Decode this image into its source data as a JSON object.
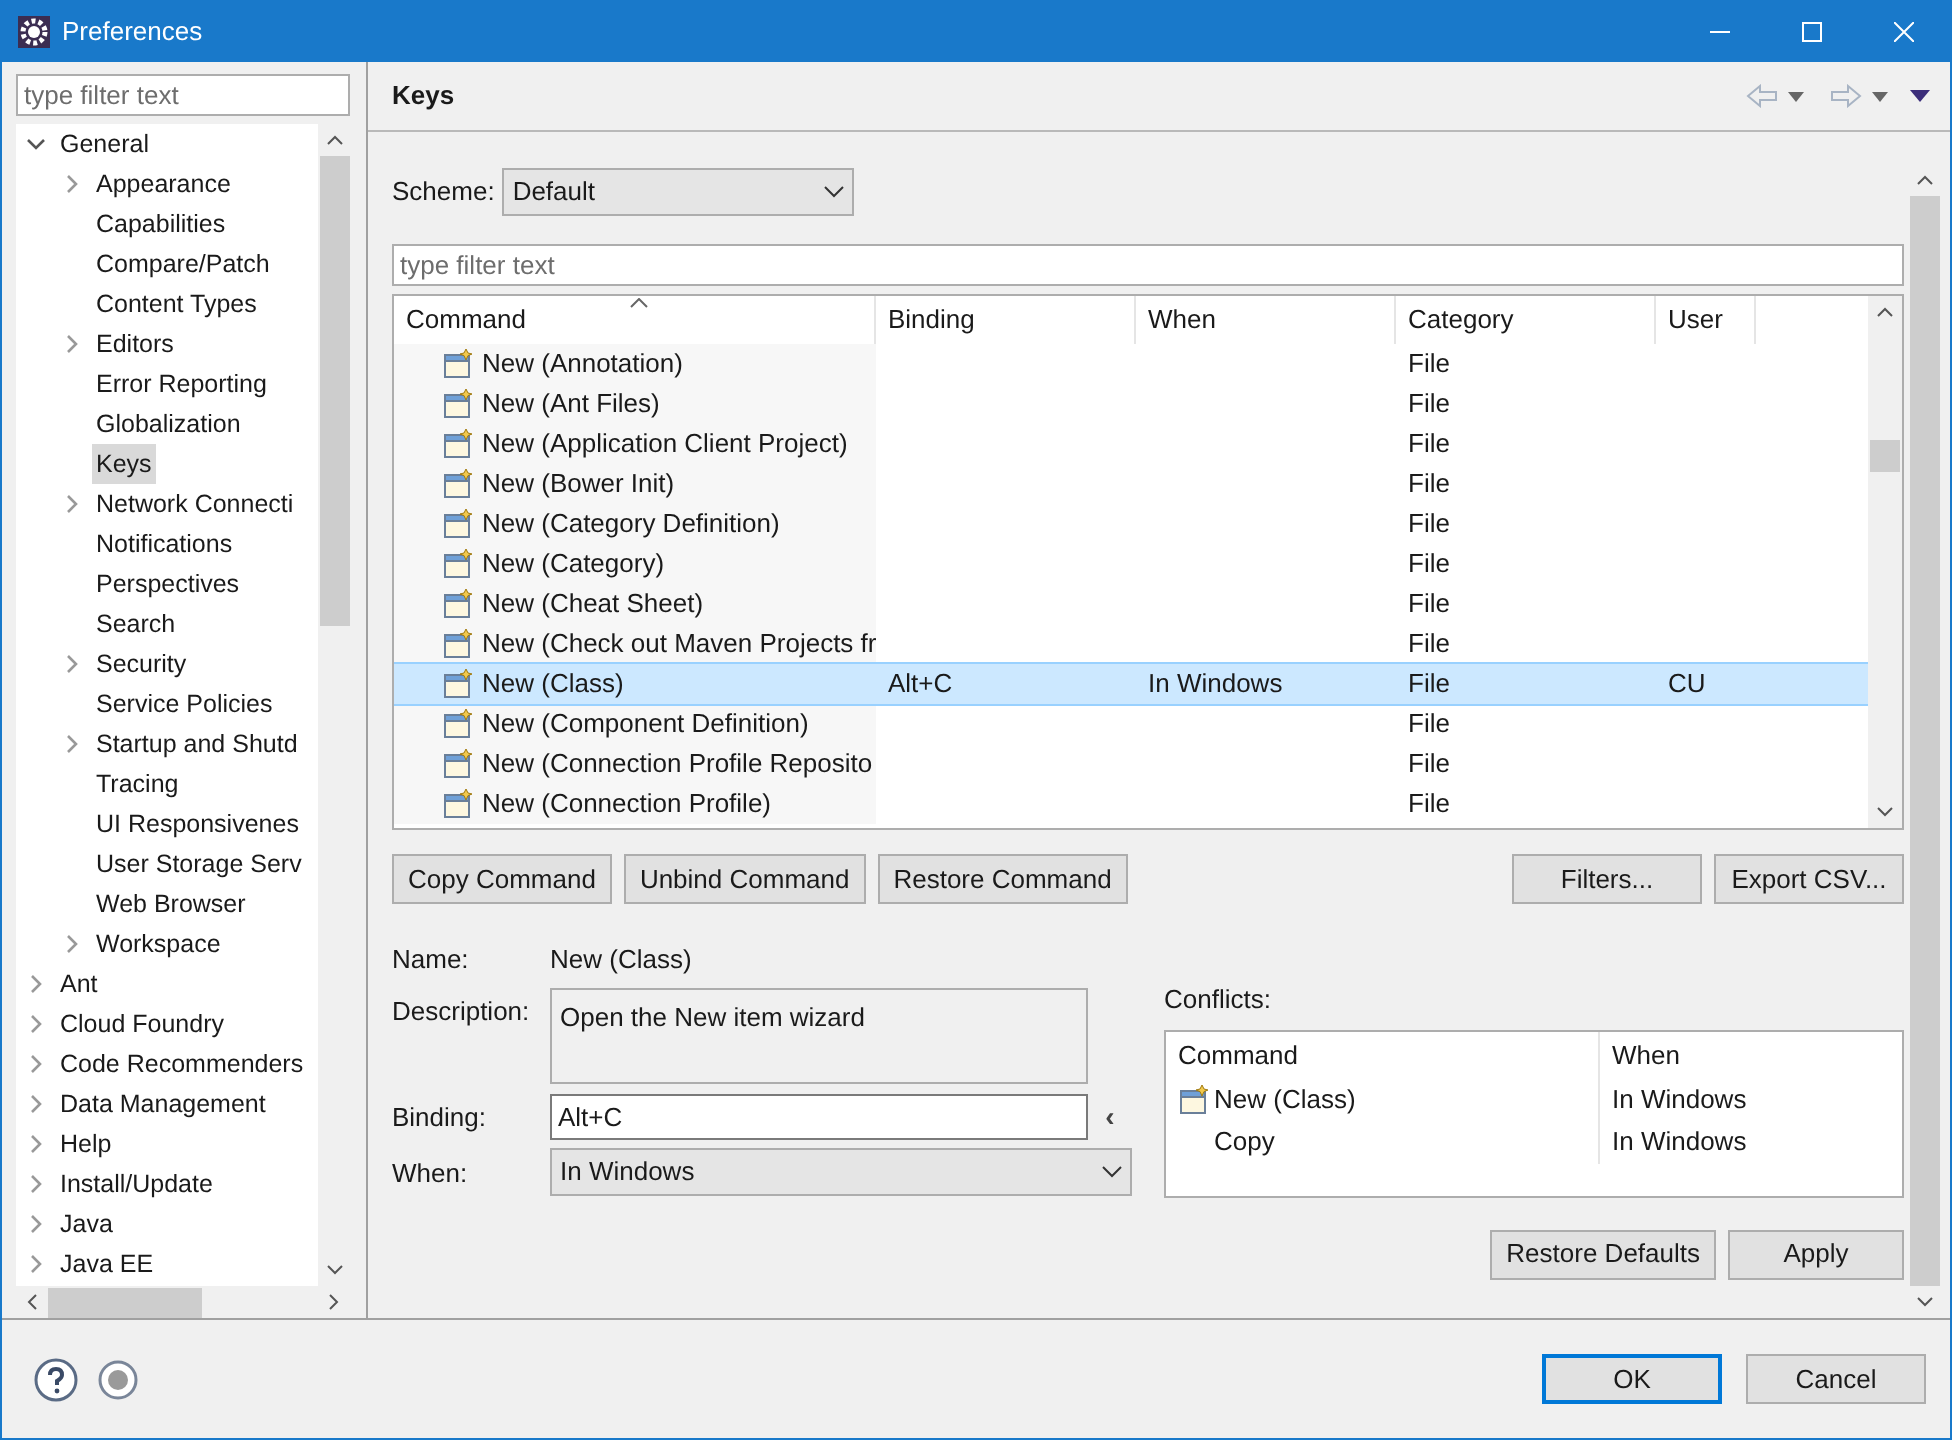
{
  "window": {
    "title": "Preferences"
  },
  "sidebar": {
    "filter": {
      "placeholder": "type filter text"
    },
    "tree": [
      {
        "label": "General",
        "kind": "expanded",
        "selected": false,
        "children": [
          {
            "label": "Appearance",
            "kind": "collapsed",
            "selected": false
          },
          {
            "label": "Capabilities",
            "kind": "leaf",
            "selected": false
          },
          {
            "label": "Compare/Patch",
            "kind": "leaf",
            "selected": false
          },
          {
            "label": "Content Types",
            "kind": "leaf",
            "selected": false
          },
          {
            "label": "Editors",
            "kind": "collapsed",
            "selected": false
          },
          {
            "label": "Error Reporting",
            "kind": "leaf",
            "selected": false
          },
          {
            "label": "Globalization",
            "kind": "leaf",
            "selected": false
          },
          {
            "label": "Keys",
            "kind": "leaf",
            "selected": true
          },
          {
            "label": "Network Connecti",
            "kind": "collapsed",
            "selected": false
          },
          {
            "label": "Notifications",
            "kind": "leaf",
            "selected": false
          },
          {
            "label": "Perspectives",
            "kind": "leaf",
            "selected": false
          },
          {
            "label": "Search",
            "kind": "leaf",
            "selected": false
          },
          {
            "label": "Security",
            "kind": "collapsed",
            "selected": false
          },
          {
            "label": "Service Policies",
            "kind": "leaf",
            "selected": false
          },
          {
            "label": "Startup and Shutd",
            "kind": "collapsed",
            "selected": false
          },
          {
            "label": "Tracing",
            "kind": "leaf",
            "selected": false
          },
          {
            "label": "UI Responsivenes",
            "kind": "leaf",
            "selected": false
          },
          {
            "label": "User Storage Serv",
            "kind": "leaf",
            "selected": false
          },
          {
            "label": "Web Browser",
            "kind": "leaf",
            "selected": false
          },
          {
            "label": "Workspace",
            "kind": "collapsed",
            "selected": false
          }
        ]
      },
      {
        "label": "Ant",
        "kind": "collapsed",
        "selected": false
      },
      {
        "label": "Cloud Foundry",
        "kind": "collapsed",
        "selected": false
      },
      {
        "label": "Code Recommenders",
        "kind": "collapsed",
        "selected": false
      },
      {
        "label": "Data Management",
        "kind": "collapsed",
        "selected": false
      },
      {
        "label": "Help",
        "kind": "collapsed",
        "selected": false
      },
      {
        "label": "Install/Update",
        "kind": "collapsed",
        "selected": false
      },
      {
        "label": "Java",
        "kind": "collapsed",
        "selected": false
      },
      {
        "label": "Java EE",
        "kind": "collapsed",
        "selected": false
      }
    ]
  },
  "page": {
    "title": "Keys",
    "scheme": {
      "label": "Scheme:",
      "value": "Default"
    },
    "filter": {
      "placeholder": "type filter text"
    },
    "table": {
      "columns": [
        "Command",
        "Binding",
        "When",
        "Category",
        "User"
      ],
      "rows": [
        {
          "command": "New (Annotation)",
          "binding": "",
          "when": "",
          "category": "File",
          "user": "",
          "selected": false
        },
        {
          "command": "New (Ant Files)",
          "binding": "",
          "when": "",
          "category": "File",
          "user": "",
          "selected": false
        },
        {
          "command": "New (Application Client Project)",
          "binding": "",
          "when": "",
          "category": "File",
          "user": "",
          "selected": false
        },
        {
          "command": "New (Bower Init)",
          "binding": "",
          "when": "",
          "category": "File",
          "user": "",
          "selected": false
        },
        {
          "command": "New (Category Definition)",
          "binding": "",
          "when": "",
          "category": "File",
          "user": "",
          "selected": false
        },
        {
          "command": "New (Category)",
          "binding": "",
          "when": "",
          "category": "File",
          "user": "",
          "selected": false
        },
        {
          "command": "New (Cheat Sheet)",
          "binding": "",
          "when": "",
          "category": "File",
          "user": "",
          "selected": false
        },
        {
          "command": "New (Check out Maven Projects fr",
          "binding": "",
          "when": "",
          "category": "File",
          "user": "",
          "selected": false
        },
        {
          "command": "New (Class)",
          "binding": "Alt+C",
          "when": "In Windows",
          "category": "File",
          "user": "CU",
          "selected": true
        },
        {
          "command": "New (Component Definition)",
          "binding": "",
          "when": "",
          "category": "File",
          "user": "",
          "selected": false
        },
        {
          "command": "New (Connection Profile Reposito",
          "binding": "",
          "when": "",
          "category": "File",
          "user": "",
          "selected": false
        },
        {
          "command": "New (Connection Profile)",
          "binding": "",
          "when": "",
          "category": "File",
          "user": "",
          "selected": false
        }
      ]
    },
    "actions": [
      "Copy Command",
      "Unbind Command",
      "Restore Command"
    ],
    "side_actions": [
      "Filters...",
      "Export CSV..."
    ],
    "details": {
      "name_label": "Name:",
      "name": "New (Class)",
      "description_label": "Description:",
      "description": "Open the New item wizard",
      "binding_label": "Binding:",
      "binding": "Alt+C",
      "binding_menu": "‹",
      "when_label": "When:",
      "when": "In Windows"
    },
    "conflicts": {
      "label": "Conflicts:",
      "columns": [
        "Command",
        "When"
      ],
      "rows": [
        {
          "command": "New (Class)",
          "when": "In Windows",
          "kind": "command"
        },
        {
          "command": "Copy",
          "when": "In Windows",
          "kind": "plain"
        }
      ]
    },
    "page_buttons": [
      "Restore Defaults",
      "Apply"
    ]
  },
  "footer": {
    "buttons": [
      "OK",
      "Cancel"
    ]
  }
}
